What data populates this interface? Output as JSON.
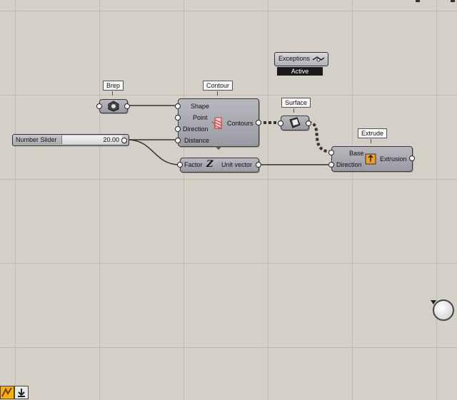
{
  "canvas": {
    "background": "#d4d0c8",
    "grid_color": "#a8a49c",
    "wire_color": "#333333"
  },
  "components": {
    "brep": {
      "tag": "Brep",
      "icon": "brep-hexagon-icon"
    },
    "contour": {
      "tag": "Contour",
      "inputs": [
        "Shape",
        "Point",
        "Direction",
        "Distance"
      ],
      "output": "Contours",
      "icon": "contour-icon"
    },
    "surface": {
      "tag": "Surface",
      "icon": "surface-icon"
    },
    "extrude": {
      "tag": "Extrude",
      "inputs": [
        "Base",
        "Direction"
      ],
      "output": "Extrusion",
      "icon": "extrude-icon"
    },
    "unit_vector": {
      "input": "Factor",
      "output": "Unit vector",
      "icon": "unit-z-icon",
      "icon_text": "Z"
    },
    "number_slider": {
      "label": "Number Slider",
      "value": "20.00"
    },
    "exceptions": {
      "label": "Exceptions",
      "status": "Active",
      "icon": "exceptions-icon"
    }
  },
  "taskbar": {
    "items": [
      "grasshopper-icon",
      "download-icon"
    ]
  },
  "nav": {
    "icon": "navigation-compass-icon"
  }
}
